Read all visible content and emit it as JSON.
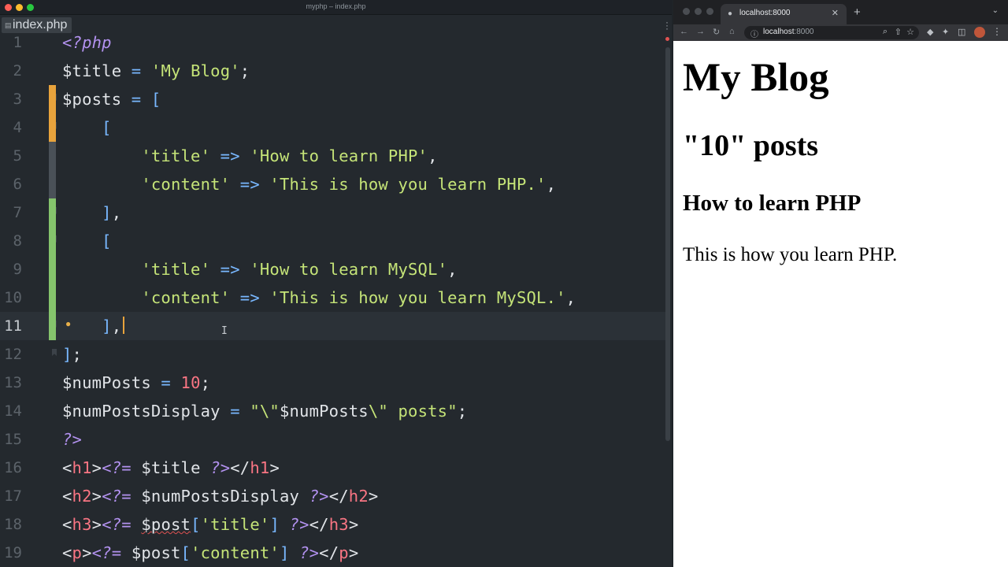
{
  "editor": {
    "window_title": "myphp – index.php",
    "tab_label": "index.php",
    "lines": [
      {
        "n": "1",
        "tokens": [
          {
            "t": "<?php",
            "c": "c-php"
          }
        ]
      },
      {
        "n": "2",
        "tokens": [
          {
            "t": "$title",
            "c": "c-var"
          },
          {
            "t": " = ",
            "c": "c-op"
          },
          {
            "t": "'My Blog'",
            "c": "c-str"
          },
          {
            "t": ";",
            "c": "c-punct"
          }
        ]
      },
      {
        "n": "3",
        "tokens": [
          {
            "t": "$posts",
            "c": "c-var"
          },
          {
            "t": " = ",
            "c": "c-op"
          },
          {
            "t": "[",
            "c": "c-br"
          }
        ]
      },
      {
        "n": "4",
        "tokens": [
          {
            "t": "    ",
            "c": "c-punct"
          },
          {
            "t": "[",
            "c": "c-br"
          }
        ]
      },
      {
        "n": "5",
        "tokens": [
          {
            "t": "        ",
            "c": "c-punct"
          },
          {
            "t": "'title'",
            "c": "c-str"
          },
          {
            "t": " => ",
            "c": "c-op"
          },
          {
            "t": "'How to learn PHP'",
            "c": "c-str"
          },
          {
            "t": ",",
            "c": "c-punct"
          }
        ]
      },
      {
        "n": "6",
        "tokens": [
          {
            "t": "        ",
            "c": "c-punct"
          },
          {
            "t": "'content'",
            "c": "c-str"
          },
          {
            "t": " => ",
            "c": "c-op"
          },
          {
            "t": "'This is how you learn PHP.'",
            "c": "c-str"
          },
          {
            "t": ",",
            "c": "c-punct"
          }
        ]
      },
      {
        "n": "7",
        "tokens": [
          {
            "t": "    ",
            "c": "c-punct"
          },
          {
            "t": "]",
            "c": "c-br"
          },
          {
            "t": ",",
            "c": "c-punct"
          }
        ]
      },
      {
        "n": "8",
        "tokens": [
          {
            "t": "    ",
            "c": "c-punct"
          },
          {
            "t": "[",
            "c": "c-br"
          }
        ]
      },
      {
        "n": "9",
        "tokens": [
          {
            "t": "        ",
            "c": "c-punct"
          },
          {
            "t": "'title'",
            "c": "c-str"
          },
          {
            "t": " => ",
            "c": "c-op"
          },
          {
            "t": "'How to learn MySQL'",
            "c": "c-str"
          },
          {
            "t": ",",
            "c": "c-punct"
          }
        ]
      },
      {
        "n": "10",
        "tokens": [
          {
            "t": "        ",
            "c": "c-punct"
          },
          {
            "t": "'content'",
            "c": "c-str"
          },
          {
            "t": " => ",
            "c": "c-op"
          },
          {
            "t": "'This is how you learn MySQL.'",
            "c": "c-str"
          },
          {
            "t": ",",
            "c": "c-punct"
          }
        ]
      },
      {
        "n": "11",
        "tokens": [
          {
            "t": "    ",
            "c": "c-punct"
          },
          {
            "t": "]",
            "c": "c-br"
          },
          {
            "t": ",",
            "c": "c-punct"
          }
        ]
      },
      {
        "n": "12",
        "tokens": [
          {
            "t": "]",
            "c": "c-br"
          },
          {
            "t": ";",
            "c": "c-punct"
          }
        ]
      },
      {
        "n": "13",
        "tokens": [
          {
            "t": "$numPosts",
            "c": "c-var"
          },
          {
            "t": " = ",
            "c": "c-op"
          },
          {
            "t": "10",
            "c": "c-num"
          },
          {
            "t": ";",
            "c": "c-punct"
          }
        ]
      },
      {
        "n": "14",
        "tokens": [
          {
            "t": "$numPostsDisplay",
            "c": "c-var"
          },
          {
            "t": " = ",
            "c": "c-op"
          },
          {
            "t": "\"\\\"",
            "c": "c-str"
          },
          {
            "t": "$numPosts",
            "c": "c-var"
          },
          {
            "t": "\\\" posts\"",
            "c": "c-str"
          },
          {
            "t": ";",
            "c": "c-punct"
          }
        ]
      },
      {
        "n": "15",
        "tokens": [
          {
            "t": "?>",
            "c": "c-php"
          }
        ]
      },
      {
        "n": "16",
        "tokens": [
          {
            "t": "<",
            "c": "c-punct"
          },
          {
            "t": "h1",
            "c": "c-tag"
          },
          {
            "t": ">",
            "c": "c-punct"
          },
          {
            "t": "<?=",
            "c": "c-php"
          },
          {
            "t": " $title ",
            "c": "c-var"
          },
          {
            "t": "?>",
            "c": "c-php"
          },
          {
            "t": "</",
            "c": "c-punct"
          },
          {
            "t": "h1",
            "c": "c-tag"
          },
          {
            "t": ">",
            "c": "c-punct"
          }
        ]
      },
      {
        "n": "17",
        "tokens": [
          {
            "t": "<",
            "c": "c-punct"
          },
          {
            "t": "h2",
            "c": "c-tag"
          },
          {
            "t": ">",
            "c": "c-punct"
          },
          {
            "t": "<?=",
            "c": "c-php"
          },
          {
            "t": " $numPostsDisplay ",
            "c": "c-var"
          },
          {
            "t": "?>",
            "c": "c-php"
          },
          {
            "t": "</",
            "c": "c-punct"
          },
          {
            "t": "h2",
            "c": "c-tag"
          },
          {
            "t": ">",
            "c": "c-punct"
          }
        ]
      },
      {
        "n": "18",
        "tokens": [
          {
            "t": "<",
            "c": "c-punct"
          },
          {
            "t": "h3",
            "c": "c-tag"
          },
          {
            "t": ">",
            "c": "c-punct"
          },
          {
            "t": "<?=",
            "c": "c-php"
          },
          {
            "t": " ",
            "c": "c-var"
          },
          {
            "t": "$post",
            "c": "c-var wavy"
          },
          {
            "t": "[",
            "c": "c-br"
          },
          {
            "t": "'title'",
            "c": "c-str"
          },
          {
            "t": "] ",
            "c": "c-br"
          },
          {
            "t": "?>",
            "c": "c-php"
          },
          {
            "t": "</",
            "c": "c-punct"
          },
          {
            "t": "h3",
            "c": "c-tag"
          },
          {
            "t": ">",
            "c": "c-punct"
          }
        ]
      },
      {
        "n": "19",
        "tokens": [
          {
            "t": "<",
            "c": "c-punct"
          },
          {
            "t": "p",
            "c": "c-tag"
          },
          {
            "t": ">",
            "c": "c-punct"
          },
          {
            "t": "<?=",
            "c": "c-php"
          },
          {
            "t": " $post",
            "c": "c-var"
          },
          {
            "t": "[",
            "c": "c-br"
          },
          {
            "t": "'content'",
            "c": "c-str"
          },
          {
            "t": "] ",
            "c": "c-br"
          },
          {
            "t": "?>",
            "c": "c-php"
          },
          {
            "t": "</",
            "c": "c-punct"
          },
          {
            "t": "p",
            "c": "c-tag"
          },
          {
            "t": ">",
            "c": "c-punct"
          }
        ]
      }
    ],
    "current_line": "11",
    "gutter_marks": [
      {
        "from": "3",
        "to": "4",
        "color": "#e8a33c"
      },
      {
        "from": "5",
        "to": "6",
        "color": "#4a5158"
      },
      {
        "from": "7",
        "to": "11",
        "color": "#85c46c"
      }
    ],
    "colors": {
      "background": "#24292e",
      "string": "#c5e478",
      "operator": "#79b8ff",
      "tag": "#f97583",
      "php": "#b392f0"
    }
  },
  "browser": {
    "tab_title": "localhost:8000",
    "url_host": "localhost",
    "url_port": ":8000",
    "page": {
      "h1": "My Blog",
      "h2": "\"10\" posts",
      "h3": "How to learn PHP",
      "p": "This is how you learn PHP."
    }
  }
}
